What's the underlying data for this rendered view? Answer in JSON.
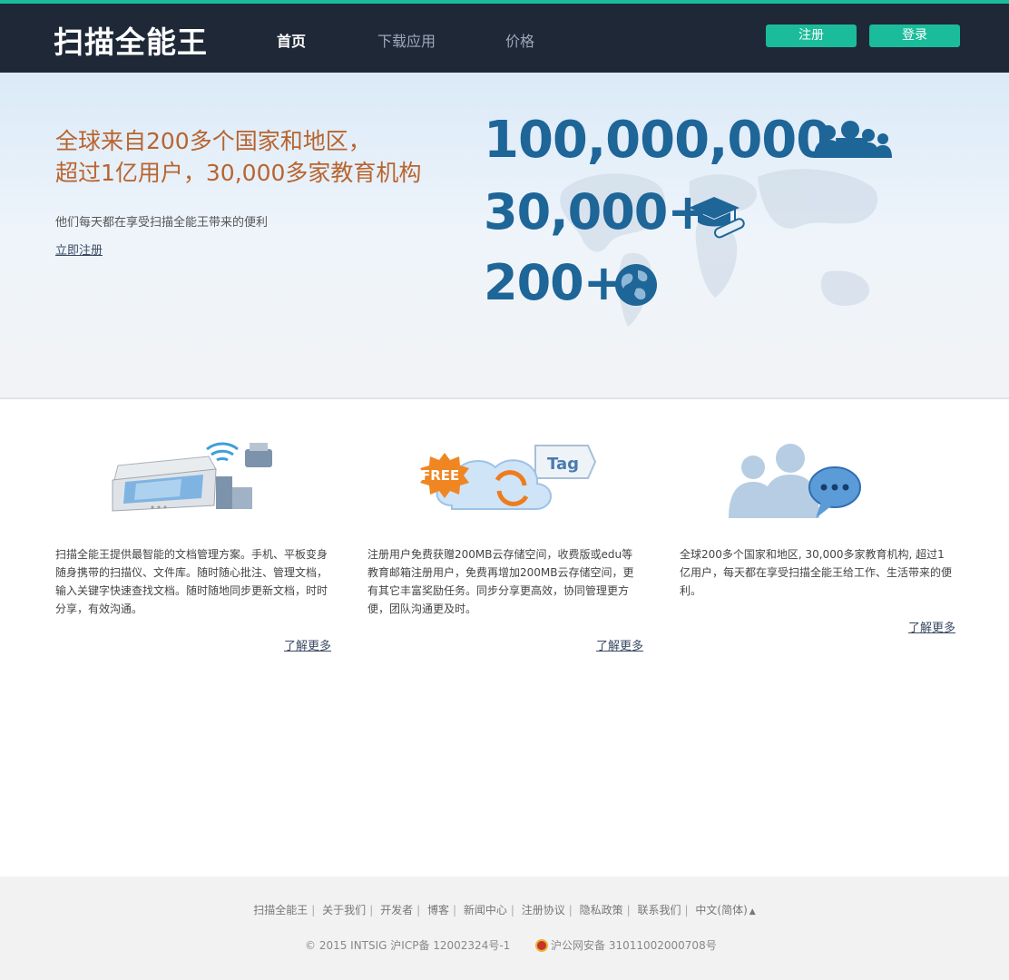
{
  "header": {
    "logo": "扫描全能王",
    "nav": [
      "首页",
      "下载应用",
      "价格"
    ],
    "register": "注册",
    "login": "登录"
  },
  "hero": {
    "title_line1": "全球来自200多个国家和地区，",
    "title_line2": "超过1亿用户，30,000多家教育机构",
    "subtitle": "他们每天都在享受扫描全能王带来的便利",
    "link": "立即注册",
    "stats": [
      "100,000,000+",
      "30,000+",
      "200+"
    ]
  },
  "features": [
    {
      "image_tag": "",
      "text": "扫描全能王提供最智能的文档管理方案。手机、平板变身随身携带的扫描仪、文件库。随时随心批注、管理文档，输入关键字快速查找文档。随时随地同步更新文档，时时分享，有效沟通。",
      "more": "了解更多"
    },
    {
      "image_tag": "FREE",
      "image_tag2": "Tag",
      "text": "注册用户免费获赠200MB云存储空间，收费版或edu等教育邮箱注册用户，免费再增加200MB云存储空间，更有其它丰富奖励任务。同步分享更高效，协同管理更方便，团队沟通更及时。",
      "more": "了解更多"
    },
    {
      "image_tag": "",
      "text": "全球200多个国家和地区, 30,000多家教育机构, 超过1亿用户，每天都在享受扫描全能王给工作、生活带来的便利。",
      "more": "了解更多"
    }
  ],
  "footer": {
    "links": [
      "扫描全能王",
      "关于我们",
      "开发者",
      "博客",
      "新闻中心",
      "注册协议",
      "隐私政策",
      "联系我们",
      "中文(简体)"
    ],
    "copyright": "© 2015 INTSIG 沪ICP备 12002324号-1",
    "police": "沪公网安备 31011002000708号"
  },
  "colors": {
    "accent": "#1bbc9b",
    "header_bg": "#1e2837",
    "stat_blue": "#1e6598",
    "hero_title": "#b8642f"
  }
}
